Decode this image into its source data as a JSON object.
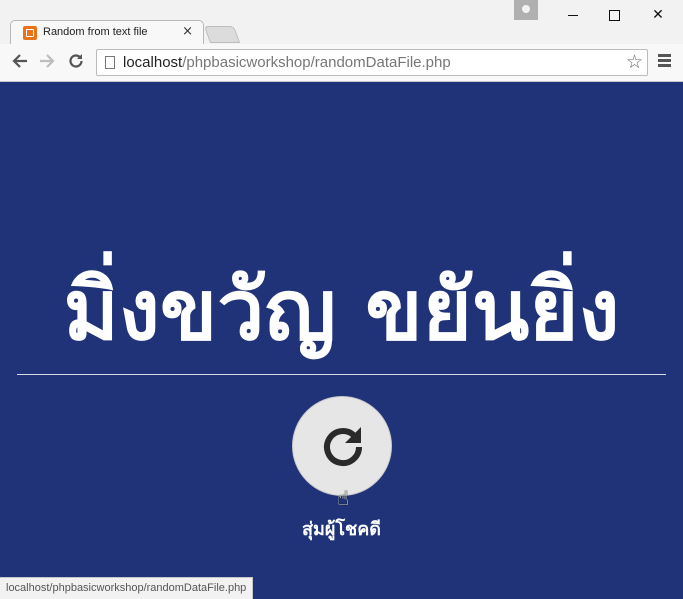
{
  "browser": {
    "tab_title": "Random from text file",
    "tab_close": "×",
    "url_host": "localhost",
    "url_path": "/phpbasicworkshop/randomDataFile.php",
    "status_url": "localhost/phpbasicworkshop/randomDataFile.php",
    "window_close": "✕",
    "icons": [
      "back-arrow-icon",
      "forward-arrow-icon",
      "reload-icon",
      "bookmark-star-icon",
      "menu-icon"
    ]
  },
  "page": {
    "background_color": "#203378",
    "random_name": "มิ่งขวัญ ขยันยิ่ง",
    "button_caption": "สุ่มผู้โชคดี",
    "button_icon": "refresh-icon"
  }
}
